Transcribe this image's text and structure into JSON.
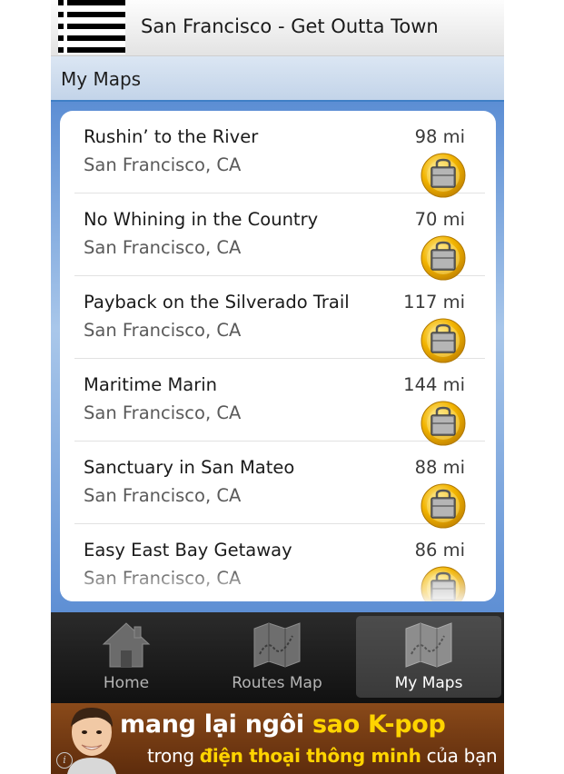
{
  "header": {
    "title": "San Francisco - Get Outta Town",
    "menu_icon": "menu-icon"
  },
  "section": {
    "title": "My Maps"
  },
  "maps": [
    {
      "name": "Rushin’ to the River",
      "location": "San Francisco, CA",
      "distance": "98 mi",
      "icon": "locked-briefcase-icon"
    },
    {
      "name": "No Whining in the Country",
      "location": "San Francisco, CA",
      "distance": "70 mi",
      "icon": "locked-briefcase-icon"
    },
    {
      "name": "Payback on the Silverado Trail",
      "location": "San Francisco, CA",
      "distance": "117 mi",
      "icon": "locked-briefcase-icon"
    },
    {
      "name": "Maritime Marin",
      "location": "San Francisco, CA",
      "distance": "144 mi",
      "icon": "locked-briefcase-icon"
    },
    {
      "name": "Sanctuary in San Mateo",
      "location": "San Francisco, CA",
      "distance": "88 mi",
      "icon": "locked-briefcase-icon"
    },
    {
      "name": "Easy East Bay Getaway",
      "location": "San Francisco, CA",
      "distance": "86 mi",
      "icon": "locked-briefcase-icon"
    }
  ],
  "tabs": [
    {
      "label": "Home",
      "icon": "home-icon",
      "active": false
    },
    {
      "label": "Routes Map",
      "icon": "map-icon",
      "active": false
    },
    {
      "label": "My Maps",
      "icon": "map-icon",
      "active": true
    }
  ],
  "ad": {
    "line1_a": "mang lại ngôi ",
    "line1_b": "sao K-pop",
    "line2_a": "trong ",
    "line2_b": "điện thoại thông minh",
    "line2_c": " của bạn",
    "info": "i"
  },
  "colors": {
    "accent": "#3f7fc6",
    "lock_gold": "#f2b400",
    "ad_highlight": "#ffd400"
  }
}
